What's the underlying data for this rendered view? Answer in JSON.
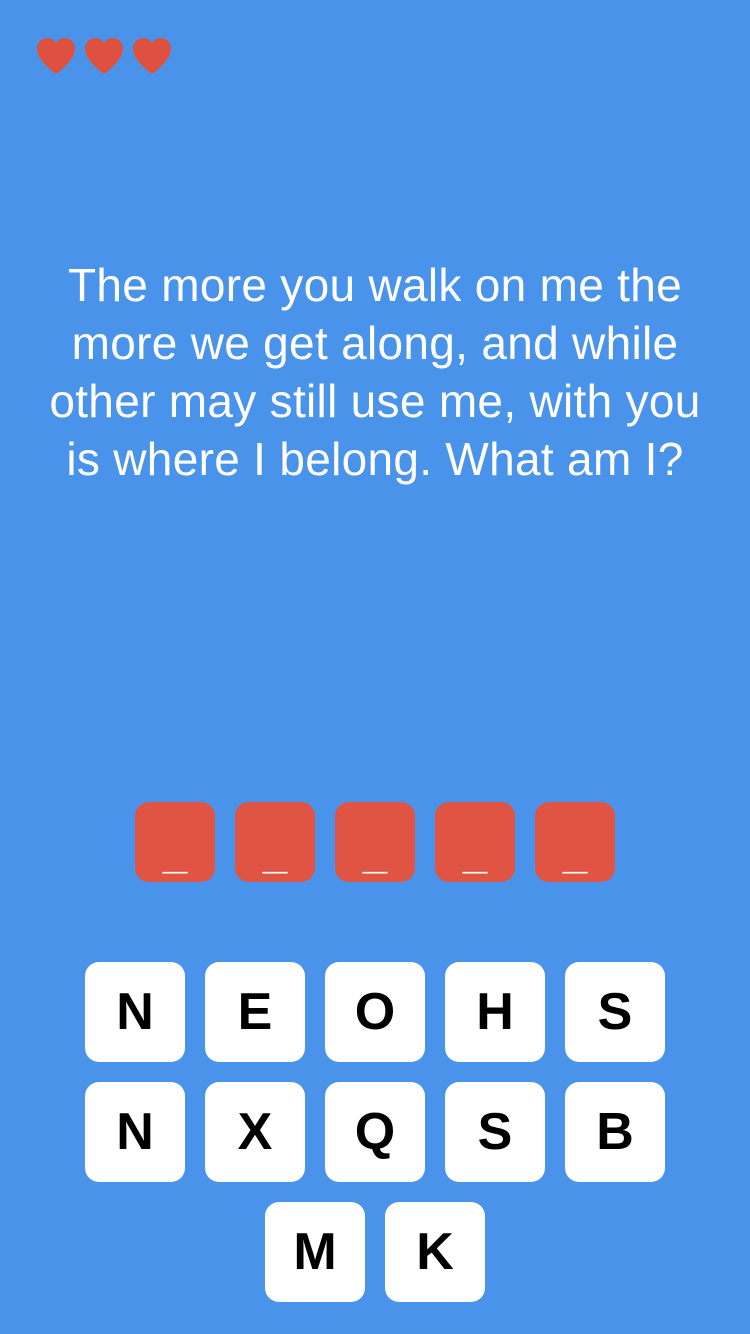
{
  "lives": {
    "count": 3,
    "icon": "heart-icon",
    "color": "#e0503f"
  },
  "riddle": {
    "text": "The more you walk on me the more we get along, and while other may still use me, with you is where I belong. What am I?"
  },
  "answer": {
    "slots": [
      "_",
      "_",
      "_",
      "_",
      "_"
    ],
    "slot_color": "#e05443"
  },
  "keyboard": {
    "rows": [
      [
        "N",
        "E",
        "O",
        "H",
        "S"
      ],
      [
        "N",
        "X",
        "Q",
        "S",
        "B"
      ],
      [
        "M",
        "K"
      ]
    ]
  },
  "colors": {
    "background": "#4a93ea",
    "key_background": "#ffffff",
    "key_text": "#000000"
  }
}
